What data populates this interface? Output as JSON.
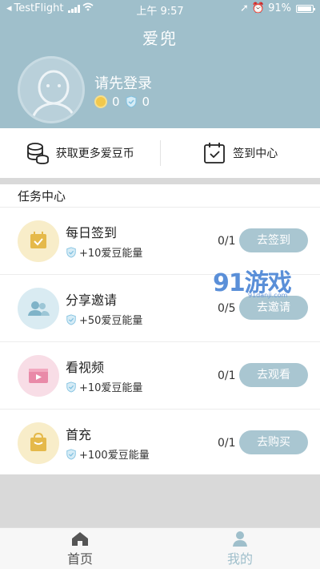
{
  "status_bar": {
    "carrier": "TestFlight",
    "time": "上午 9:57",
    "battery": "91%"
  },
  "header": {
    "title": "爱兜"
  },
  "profile": {
    "login_prompt": "请先登录",
    "coins": "0",
    "energy": "0"
  },
  "quick_actions": [
    {
      "label": "获取更多爱豆币",
      "icon": "coins-stack-icon"
    },
    {
      "label": "签到中心",
      "icon": "calendar-check-icon"
    }
  ],
  "section_title": "任务中心",
  "tasks": [
    {
      "name": "每日签到",
      "reward": "+10爱豆能量",
      "progress": "0/1",
      "button": "去签到",
      "icon": "calendar-icon",
      "icon_bg": "#f8edc9",
      "icon_color": "#e5b94a"
    },
    {
      "name": "分享邀请",
      "reward": "+50爱豆能量",
      "progress": "0/5",
      "button": "去邀请",
      "icon": "users-icon",
      "icon_bg": "#d9ebf2",
      "icon_color": "#7fb3c8"
    },
    {
      "name": "看视频",
      "reward": "+10爱豆能量",
      "progress": "0/1",
      "button": "去观看",
      "icon": "video-icon",
      "icon_bg": "#f8dde6",
      "icon_color": "#e98aa8"
    },
    {
      "name": "首充",
      "reward": "+100爱豆能量",
      "progress": "0/1",
      "button": "去购买",
      "icon": "shopping-bag-icon",
      "icon_bg": "#f8edc9",
      "icon_color": "#e5b94a"
    }
  ],
  "tabbar": {
    "home": "首页",
    "mine": "我的"
  },
  "watermark": {
    "main": "91游戏",
    "sub": "91danji.com"
  },
  "colors": {
    "accent": "#9fbfcb",
    "button": "#a9c6d1"
  }
}
